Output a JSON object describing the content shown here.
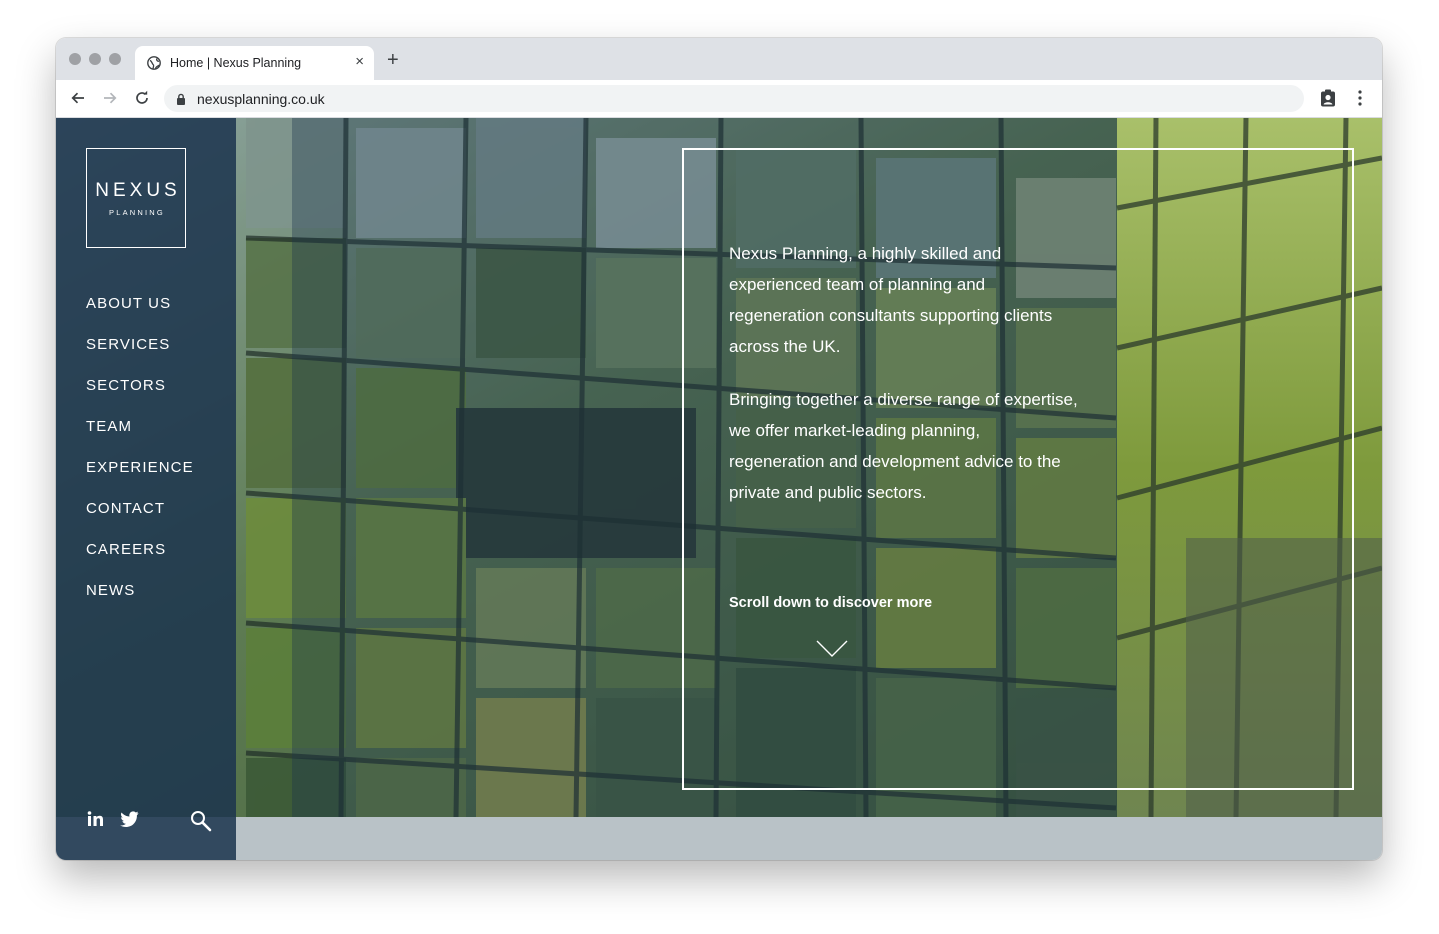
{
  "browser": {
    "tab_title": "Home | Nexus Planning",
    "tab_close": "×",
    "new_tab": "+",
    "url": "nexusplanning.co.uk"
  },
  "site": {
    "logo_main": "NEXUS",
    "logo_sub": "PLANNING",
    "nav": [
      {
        "label": "ABOUT US"
      },
      {
        "label": "SERVICES"
      },
      {
        "label": "SECTORS"
      },
      {
        "label": "TEAM"
      },
      {
        "label": "EXPERIENCE"
      },
      {
        "label": "CONTACT"
      },
      {
        "label": "CAREERS"
      },
      {
        "label": "NEWS"
      }
    ],
    "intro_1": "Nexus Planning, a highly skilled and experienced team of planning and regeneration consultants supporting clients across the UK.",
    "intro_2": "Bringing together a diverse range of expertise, we offer market-leading planning, regeneration and development advice to the private and public sectors.",
    "scroll_label": "Scroll down to discover more"
  },
  "icons": {
    "social": [
      "linkedin-icon",
      "twitter-icon"
    ],
    "search": "search-icon"
  },
  "colors": {
    "sidebar": "#1c344e",
    "tab_strip": "#dee1e6",
    "footer_band": "#b9c2c7"
  }
}
